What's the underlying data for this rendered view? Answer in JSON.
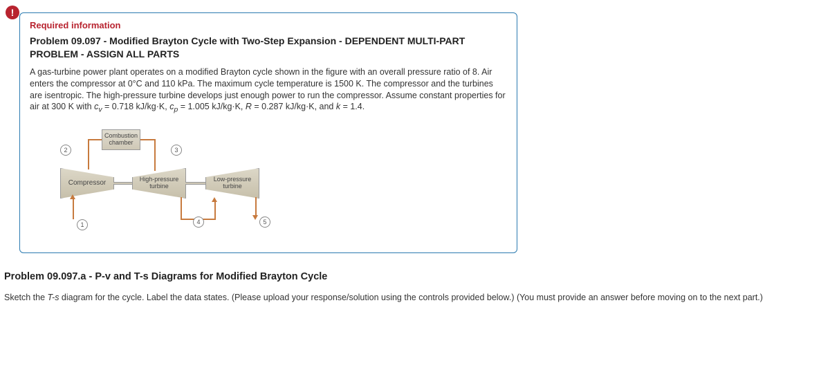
{
  "alert_symbol": "!",
  "required_label": "Required information",
  "problem_title": "Problem 09.097 - Modified Brayton Cycle with Two-Step Expansion - DEPENDENT MULTI-PART PROBLEM - ASSIGN ALL PARTS",
  "problem_body_html": "A gas-turbine power plant operates on a modified Brayton cycle shown in the figure with an overall pressure ratio of 8. Air enters the compressor at 0°C and 110 kPa. The maximum cycle temperature is 1500 K. The compressor and the turbines are isentropic. The high-pressure turbine develops just enough power to run the compressor. Assume constant properties for air at 300 K with c_v = 0.718 kJ/kg·K, c_p = 1.005 kJ/kg·K, R = 0.287 kJ/kg·K, and k = 1.4.",
  "diagram": {
    "combustion": "Combustion chamber",
    "compressor": "Compressor",
    "hp_turbine": "High-pressure turbine",
    "lp_turbine": "Low-pressure turbine",
    "states": {
      "s1": "1",
      "s2": "2",
      "s3": "3",
      "s4": "4",
      "s5": "5"
    }
  },
  "sub_title": "Problem 09.097.a - P-v and T-s Diagrams for Modified Brayton Cycle",
  "sub_body_prefix": "Sketch the ",
  "sub_body_ts": "T-s",
  "sub_body_suffix": " diagram for the cycle. Label the data states. (Please upload your response/solution using the controls provided below.) (You must provide an answer before moving on to the next part.)"
}
